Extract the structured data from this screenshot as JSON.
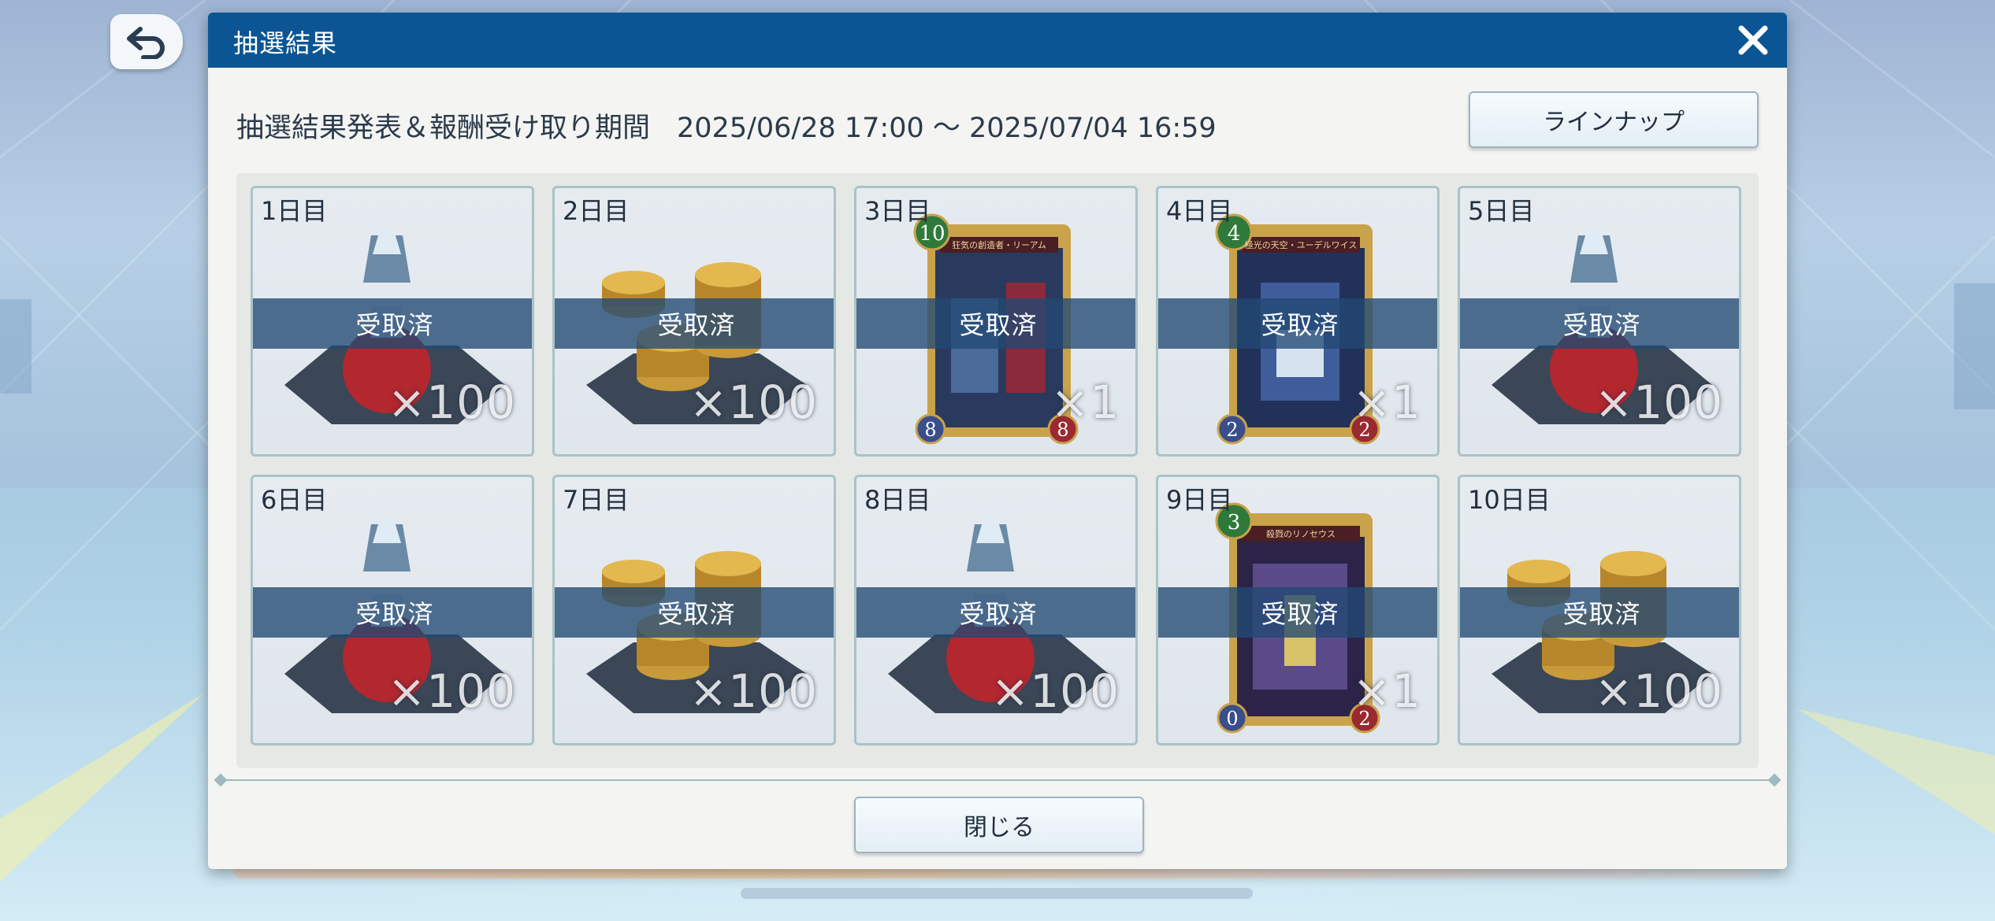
{
  "dialog": {
    "title": "抽選結果",
    "period_label": "抽選結果発表＆報酬受け取り期間",
    "period_value": "2025/06/28 17:00 ～ 2025/07/04 16:59",
    "lineup_label": "ラインナップ",
    "close_label": "閉じる"
  },
  "icons": {
    "back": "back-arrow-icon",
    "close": "close-x-icon"
  },
  "colors": {
    "titlebar": "#0b5594",
    "claimed_band": "#214973",
    "card_border": "#a9c3c8"
  },
  "rewards": [
    {
      "day": "1日目",
      "item": "potion",
      "status": "受取済",
      "qty": "×100"
    },
    {
      "day": "2日目",
      "item": "coins",
      "status": "受取済",
      "qty": "×100"
    },
    {
      "day": "3日目",
      "item": "card",
      "status": "受取済",
      "qty": "×1",
      "card_cost": "10",
      "card_name": "狂気の創造者・リーアム",
      "card_atk": "8",
      "card_def": "8"
    },
    {
      "day": "4日目",
      "item": "card",
      "status": "受取済",
      "qty": "×1",
      "card_cost": "4",
      "card_name": "極光の天空・ユーデルワイス",
      "card_atk": "2",
      "card_def": "2"
    },
    {
      "day": "5日目",
      "item": "potion",
      "status": "受取済",
      "qty": "×100"
    },
    {
      "day": "6日目",
      "item": "potion",
      "status": "受取済",
      "qty": "×100"
    },
    {
      "day": "7日目",
      "item": "coins",
      "status": "受取済",
      "qty": "×100"
    },
    {
      "day": "8日目",
      "item": "potion",
      "status": "受取済",
      "qty": "×100"
    },
    {
      "day": "9日目",
      "item": "card",
      "status": "受取済",
      "qty": "×1",
      "card_cost": "3",
      "card_name": "殺戮のリノセウス",
      "card_atk": "0",
      "card_def": "2"
    },
    {
      "day": "10日目",
      "item": "coins",
      "status": "受取済",
      "qty": "×100"
    }
  ]
}
